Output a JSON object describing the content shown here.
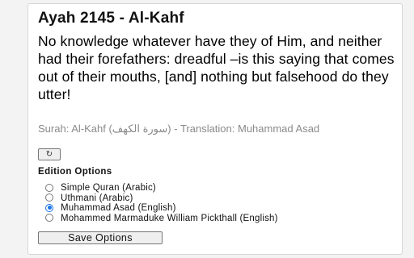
{
  "ayah": {
    "title": "Ayah 2145 - Al-Kahf",
    "verse": "No knowledge whatever have they of Him, and neither had their forefathers: dreadful –is this saying that comes out of their mouths, [and] nothing but falsehood do they utter!",
    "source_line": "Surah: Al-Kahf (سورة الكهف) - Translation: Muhammad Asad",
    "refresh_glyph": "↻",
    "refresh_icon": "refresh-icon"
  },
  "edition_options": {
    "heading": "Edition Options",
    "options": [
      {
        "label": "Simple Quran (Arabic)",
        "selected": false
      },
      {
        "label": "Uthmani (Arabic)",
        "selected": false
      },
      {
        "label": "Muhammad Asad (English)",
        "selected": true
      },
      {
        "label": "Mohammed Marmaduke William Pickthall (English)",
        "selected": false
      }
    ],
    "selected_value": "Muhammad Asad (English)",
    "save_label": "Save Options"
  },
  "colors": {
    "page_background": "#f3f3f3",
    "panel_background": "#ffffff",
    "source_text": "#8a8a8a",
    "radio_selected": "#1a73e8",
    "button_background": "#efefef"
  }
}
